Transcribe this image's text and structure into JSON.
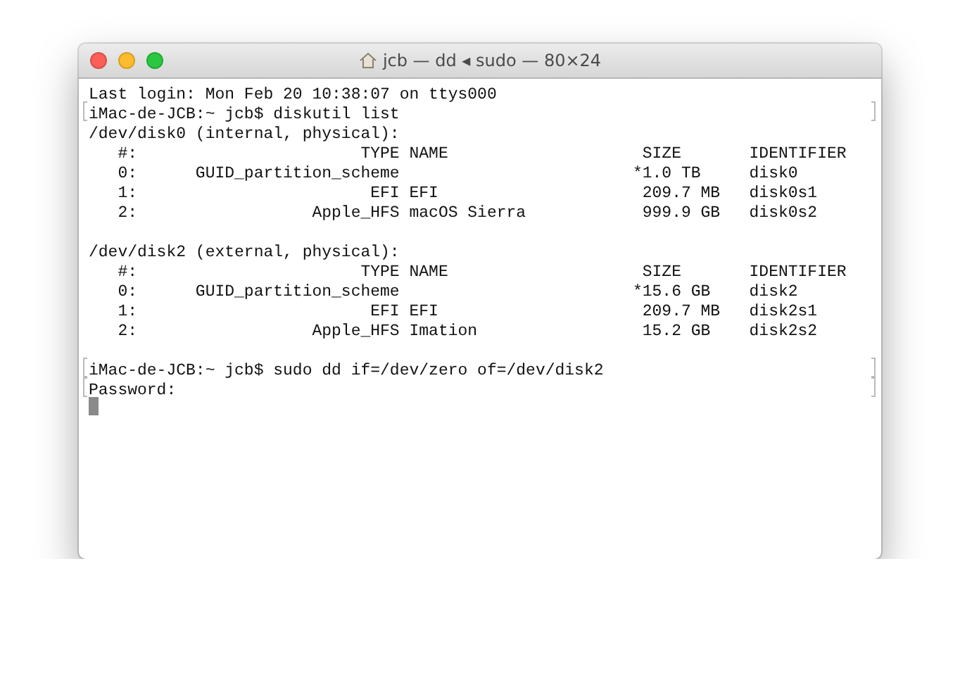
{
  "window": {
    "title": "jcb — dd ◂ sudo — 80×24"
  },
  "lines": [
    {
      "text": "Last login: Mon Feb 20 10:38:07 on ttys000",
      "marked": false
    },
    {
      "text": "iMac-de-JCB:~ jcb$ diskutil list",
      "marked": true
    },
    {
      "text": "/dev/disk0 (internal, physical):",
      "marked": false
    },
    {
      "text": "   #:                       TYPE NAME                    SIZE       IDENTIFIER",
      "marked": false
    },
    {
      "text": "   0:      GUID_partition_scheme                        *1.0 TB     disk0",
      "marked": false
    },
    {
      "text": "   1:                        EFI EFI                     209.7 MB   disk0s1",
      "marked": false
    },
    {
      "text": "   2:                  Apple_HFS macOS Sierra            999.9 GB   disk0s2",
      "marked": false
    },
    {
      "marked": false
    },
    {
      "text": "/dev/disk2 (external, physical):",
      "marked": false
    },
    {
      "text": "   #:                       TYPE NAME                    SIZE       IDENTIFIER",
      "marked": false
    },
    {
      "text": "   0:      GUID_partition_scheme                        *15.6 GB    disk2",
      "marked": false
    },
    {
      "text": "   1:                        EFI EFI                     209.7 MB   disk2s1",
      "marked": false
    },
    {
      "text": "   2:                  Apple_HFS Imation                 15.2 GB    disk2s2",
      "marked": false
    },
    {
      "marked": false
    },
    {
      "text": "iMac-de-JCB:~ jcb$ sudo dd if=/dev/zero of=/dev/disk2",
      "marked": true
    },
    {
      "text": "Password:",
      "marked": true
    }
  ],
  "cursor": {
    "visible": true
  }
}
